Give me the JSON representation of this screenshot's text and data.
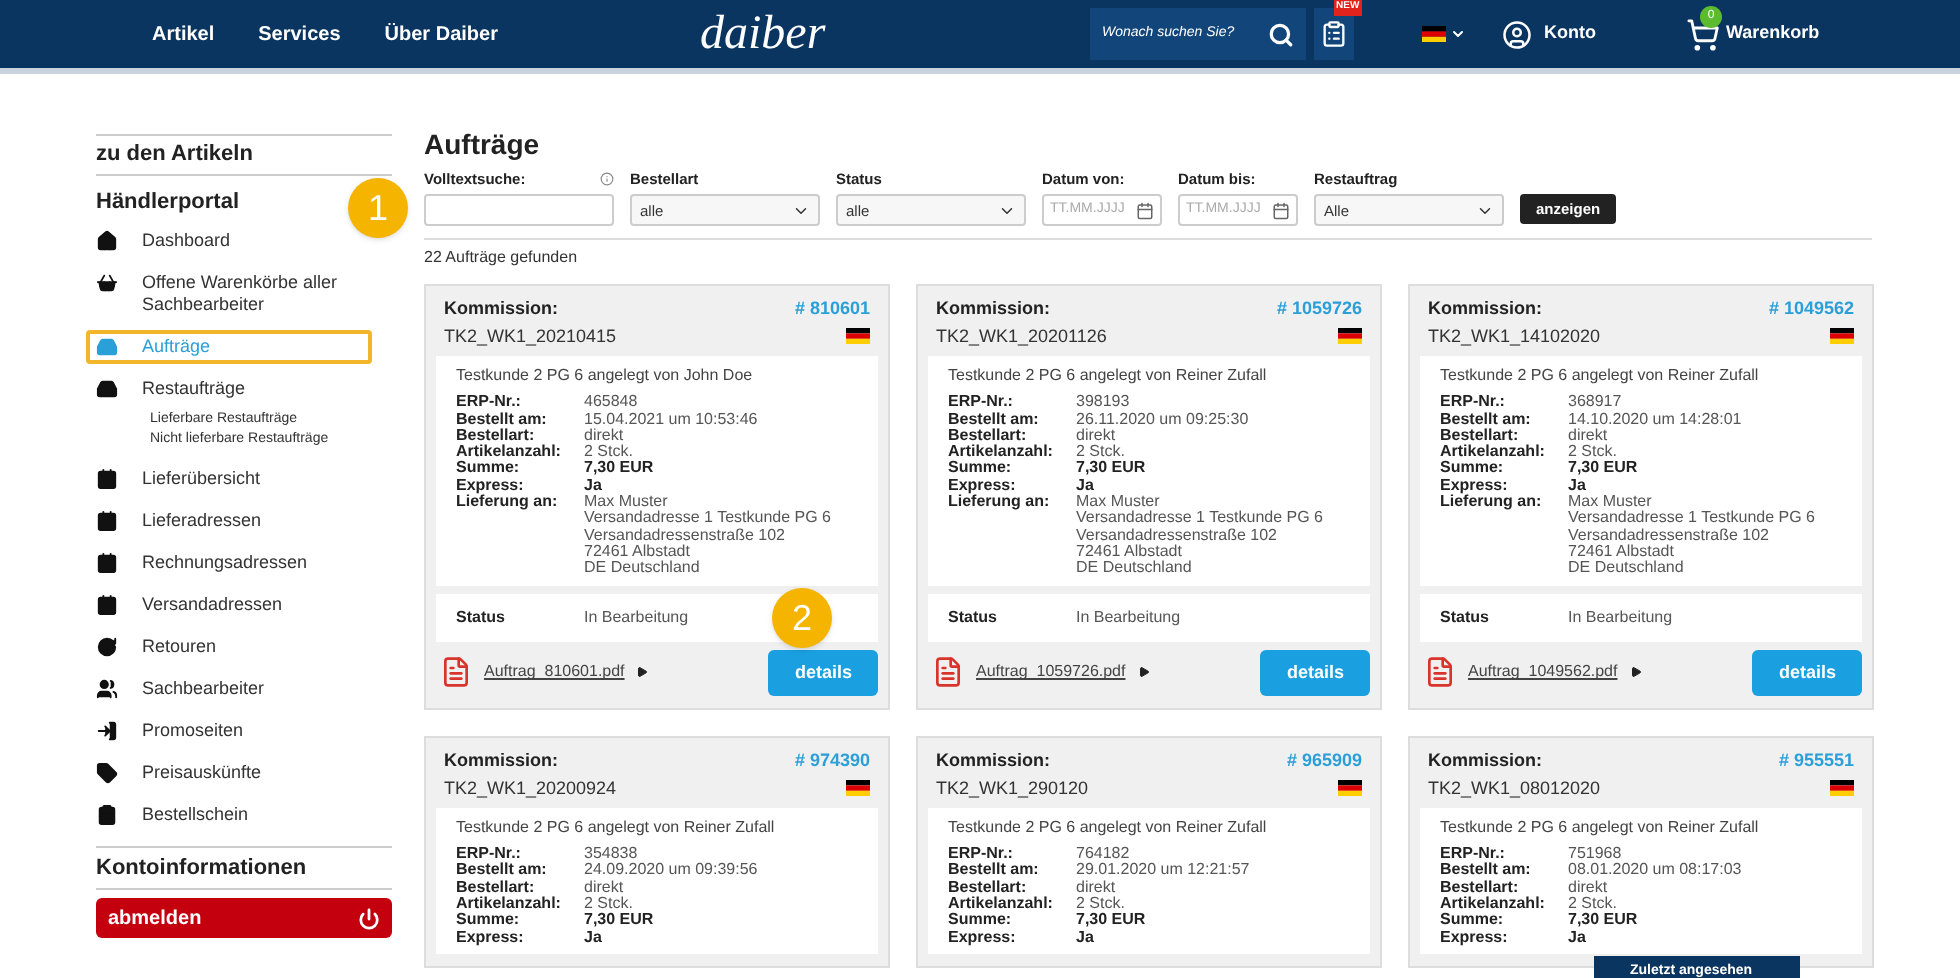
{
  "header": {
    "nav": [
      "Artikel",
      "Services",
      "Über Daiber"
    ],
    "logo": "daiber",
    "search": {
      "placeholder": "Wonach suchen Sie?"
    },
    "new_badge": "NEW",
    "account": "Konto",
    "cart": {
      "label": "Warenkorb",
      "count": "0"
    }
  },
  "sidebar": {
    "back_link": "zu den Artikeln",
    "section": "Händlerportal",
    "items": [
      {
        "label": "Dashboard",
        "selected": false
      },
      {
        "label": "Offene Warenkörbe aller Sachbearbeiter",
        "selected": false
      },
      {
        "label": "Aufträge",
        "selected": true
      },
      {
        "label": "Restaufträge",
        "selected": false,
        "children": [
          {
            "label": "Lieferbare Restaufträge"
          },
          {
            "label": "Nicht lieferbare Restaufträge"
          }
        ]
      },
      {
        "label": "Lieferübersicht",
        "selected": false
      },
      {
        "label": "Lieferadressen",
        "selected": false
      },
      {
        "label": "Rechnungsadressen",
        "selected": false
      },
      {
        "label": "Versandadressen",
        "selected": false
      },
      {
        "label": "Retouren",
        "selected": false
      },
      {
        "label": "Sachbearbeiter",
        "selected": false
      },
      {
        "label": "Promoseiten",
        "selected": false
      },
      {
        "label": "Preisauskünfte",
        "selected": false
      },
      {
        "label": "Bestellschein",
        "selected": false
      }
    ],
    "account_heading": "Kontoinformationen",
    "logout": "abmelden"
  },
  "main": {
    "title": "Aufträge",
    "filters": [
      {
        "kind": "text",
        "label": "Volltextsuche:"
      },
      {
        "kind": "select",
        "label": "Bestellart",
        "value": "alle"
      },
      {
        "kind": "select",
        "label": "Status",
        "value": "alle"
      },
      {
        "kind": "date",
        "label": "Datum von:",
        "placeholder": "TT.MM.JJJJ"
      },
      {
        "kind": "date",
        "label": "Datum bis:",
        "placeholder": "TT.MM.JJJJ"
      },
      {
        "kind": "select",
        "label": "Restauftrag",
        "value": "Alle"
      }
    ],
    "submit": "anzeigen",
    "result_count": "22 Aufträge gefunden",
    "orders": [
      {
        "commission_label": "Kommission:",
        "commission": "TK2_WK1_20210415",
        "number": "# 810601",
        "note": "Testkunde 2 PG 6 angelegt von John Doe",
        "fields": [
          {
            "label": "ERP-Nr.:",
            "value": "465848"
          },
          {
            "label": "Bestellt am:",
            "value": "15.04.2021 um 10:53:46"
          },
          {
            "label": "Bestellart:",
            "value": "direkt"
          },
          {
            "label": "Artikelanzahl:",
            "value": "2 Stck."
          },
          {
            "label": "Summe:",
            "value": "7,30 EUR",
            "bold": true
          },
          {
            "label": "Express:",
            "value": "Ja",
            "bold": true
          },
          {
            "label": "Lieferung an:",
            "lines": [
              "Max Muster",
              "Versandadresse 1 Testkunde PG 6",
              "Versandadressenstraße 102",
              "72461 Albstadt",
              "DE Deutschland"
            ]
          }
        ],
        "status_label": "Status",
        "status": "In Bearbeitung",
        "pdf": "Auftrag_810601.pdf",
        "details": "details"
      },
      {
        "commission_label": "Kommission:",
        "commission": "TK2_WK1_20201126",
        "number": "# 1059726",
        "note": "Testkunde 2 PG 6 angelegt von Reiner Zufall",
        "fields": [
          {
            "label": "ERP-Nr.:",
            "value": "398193"
          },
          {
            "label": "Bestellt am:",
            "value": "26.11.2020 um 09:25:30"
          },
          {
            "label": "Bestellart:",
            "value": "direkt"
          },
          {
            "label": "Artikelanzahl:",
            "value": "2 Stck."
          },
          {
            "label": "Summe:",
            "value": "7,30 EUR",
            "bold": true
          },
          {
            "label": "Express:",
            "value": "Ja",
            "bold": true
          },
          {
            "label": "Lieferung an:",
            "lines": [
              "Max Muster",
              "Versandadresse 1 Testkunde PG 6",
              "Versandadressenstraße 102",
              "72461 Albstadt",
              "DE Deutschland"
            ]
          }
        ],
        "status_label": "Status",
        "status": "In Bearbeitung",
        "pdf": "Auftrag_1059726.pdf",
        "details": "details"
      },
      {
        "commission_label": "Kommission:",
        "commission": "TK2_WK1_14102020",
        "number": "# 1049562",
        "note": "Testkunde 2 PG 6 angelegt von Reiner Zufall",
        "fields": [
          {
            "label": "ERP-Nr.:",
            "value": "368917"
          },
          {
            "label": "Bestellt am:",
            "value": "14.10.2020 um 14:28:01"
          },
          {
            "label": "Bestellart:",
            "value": "direkt"
          },
          {
            "label": "Artikelanzahl:",
            "value": "2 Stck."
          },
          {
            "label": "Summe:",
            "value": "7,30 EUR",
            "bold": true
          },
          {
            "label": "Express:",
            "value": "Ja",
            "bold": true
          },
          {
            "label": "Lieferung an:",
            "lines": [
              "Max Muster",
              "Versandadresse 1 Testkunde PG 6",
              "Versandadressenstraße 102",
              "72461 Albstadt",
              "DE Deutschland"
            ]
          }
        ],
        "status_label": "Status",
        "status": "In Bearbeitung",
        "pdf": "Auftrag_1049562.pdf",
        "details": "details"
      },
      {
        "commission_label": "Kommission:",
        "commission": "TK2_WK1_20200924",
        "number": "# 974390",
        "note": "Testkunde 2 PG 6 angelegt von Reiner Zufall",
        "fields": [
          {
            "label": "ERP-Nr.:",
            "value": "354838"
          },
          {
            "label": "Bestellt am:",
            "value": "24.09.2020 um 09:39:56"
          },
          {
            "label": "Bestellart:",
            "value": "direkt"
          },
          {
            "label": "Artikelanzahl:",
            "value": "2 Stck."
          },
          {
            "label": "Summe:",
            "value": "7,30 EUR",
            "bold": true
          },
          {
            "label": "Express:",
            "value": "Ja",
            "bold": true
          }
        ]
      },
      {
        "commission_label": "Kommission:",
        "commission": "TK2_WK1_290120",
        "number": "# 965909",
        "note": "Testkunde 2 PG 6 angelegt von Reiner Zufall",
        "fields": [
          {
            "label": "ERP-Nr.:",
            "value": "764182"
          },
          {
            "label": "Bestellt am:",
            "value": "29.01.2020 um 12:21:57"
          },
          {
            "label": "Bestellart:",
            "value": "direkt"
          },
          {
            "label": "Artikelanzahl:",
            "value": "2 Stck."
          },
          {
            "label": "Summe:",
            "value": "7,30 EUR",
            "bold": true
          },
          {
            "label": "Express:",
            "value": "Ja",
            "bold": true
          }
        ]
      },
      {
        "commission_label": "Kommission:",
        "commission": "TK2_WK1_08012020",
        "number": "# 955551",
        "note": "Testkunde 2 PG 6 angelegt von Reiner Zufall",
        "fields": [
          {
            "label": "ERP-Nr.:",
            "value": "751968"
          },
          {
            "label": "Bestellt am:",
            "value": "08.01.2020 um 08:17:03"
          },
          {
            "label": "Bestellart:",
            "value": "direkt"
          },
          {
            "label": "Artikelanzahl:",
            "value": "2 Stck."
          },
          {
            "label": "Summe:",
            "value": "7,30 EUR",
            "bold": true
          },
          {
            "label": "Express:",
            "value": "Ja",
            "bold": true
          }
        ]
      }
    ]
  },
  "recently_viewed": "Zuletzt angesehen",
  "annotations": [
    "1",
    "2"
  ]
}
